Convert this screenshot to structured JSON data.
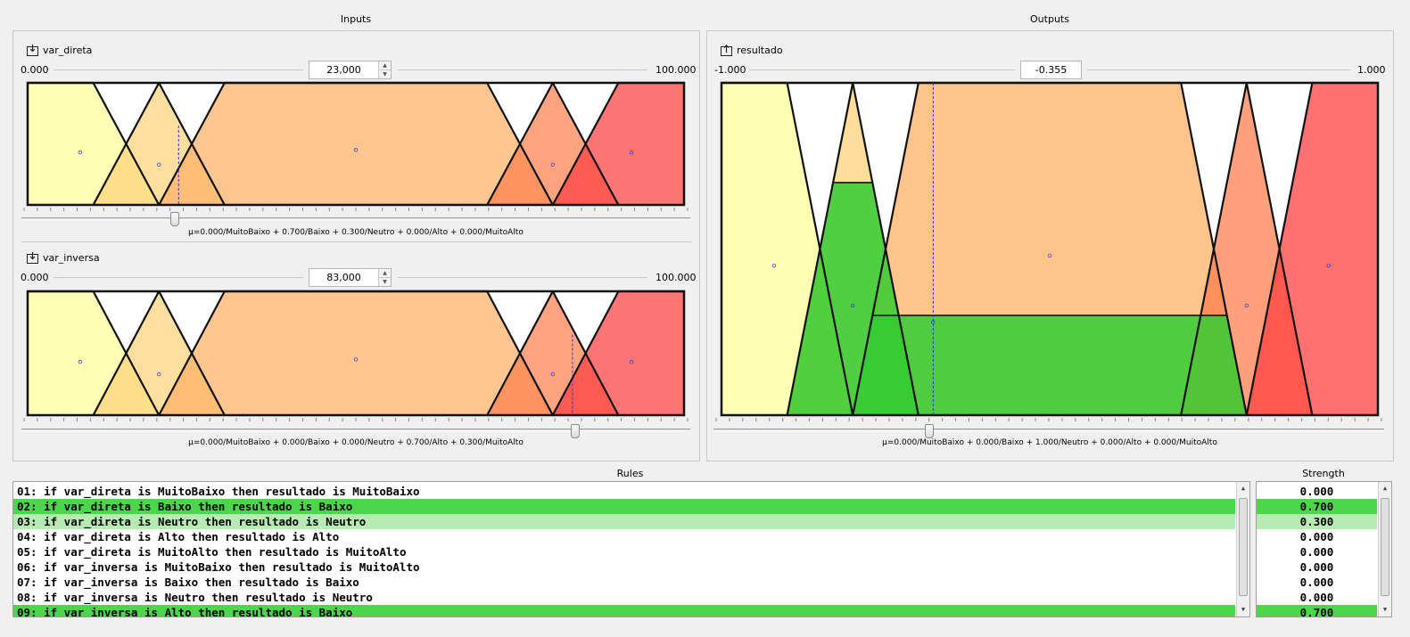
{
  "inputs_title": "Inputs",
  "outputs_title": "Outputs",
  "rules_title": "Rules",
  "strength_title": "Strength",
  "inputs": [
    {
      "name": "var_direta",
      "min_label": "0.000",
      "max_label": "100.000",
      "value": "23,000",
      "value_num": 23,
      "mu": "μ=0.000/MuitoBaixo + 0.700/Baixo + 0.300/Neutro + 0.000/Alto + 0.000/MuitoAlto"
    },
    {
      "name": "var_inversa",
      "min_label": "0.000",
      "max_label": "100.000",
      "value": "83,000",
      "value_num": 83,
      "mu": "μ=0.000/MuitoBaixo + 0.000/Baixo + 0.000/Neutro + 0.700/Alto + 0.300/MuitoAlto"
    }
  ],
  "output": {
    "name": "resultado",
    "min_label": "-1.000",
    "max_label": "1.000",
    "value": "-0.355",
    "value_num": -0.355,
    "mu": "μ=0.000/MuitoBaixo + 0.000/Baixo + 1.000/Neutro + 0.000/Alto + 0.000/MuitoAlto"
  },
  "colors": {
    "muito_baixo": "#ffff99",
    "baixo": "#ffd27a",
    "neutro": "#ffb066",
    "alto": "#ff8050",
    "muito_alto": "#ff4040",
    "activation": "#33cc33",
    "rule_strong": "#4cd64c",
    "rule_mid": "#b6ecb4"
  },
  "rules": [
    {
      "text": "01: if var_direta is MuitoBaixo then resultado is MuitoBaixo",
      "strength": "0.000",
      "level": "none"
    },
    {
      "text": "02: if var_direta is Baixo then resultado is Baixo",
      "strength": "0.700",
      "level": "strong"
    },
    {
      "text": "03: if var_direta is Neutro then resultado is Neutro",
      "strength": "0.300",
      "level": "mid"
    },
    {
      "text": "04: if var_direta is Alto then resultado is Alto",
      "strength": "0.000",
      "level": "none"
    },
    {
      "text": "05: if var_direta is MuitoAlto then resultado is MuitoAlto",
      "strength": "0.000",
      "level": "none"
    },
    {
      "text": "06: if var_inversa is MuitoBaixo then resultado is MuitoAlto",
      "strength": "0.000",
      "level": "none"
    },
    {
      "text": "07: if var_inversa is Baixo then resultado is Baixo",
      "strength": "0.000",
      "level": "none"
    },
    {
      "text": "08: if var_inversa is Neutro then resultado is Neutro",
      "strength": "0.000",
      "level": "none"
    },
    {
      "text": "09: if var_inversa is Alto then resultado is Baixo",
      "strength": "0.700",
      "level": "strong"
    }
  ]
}
